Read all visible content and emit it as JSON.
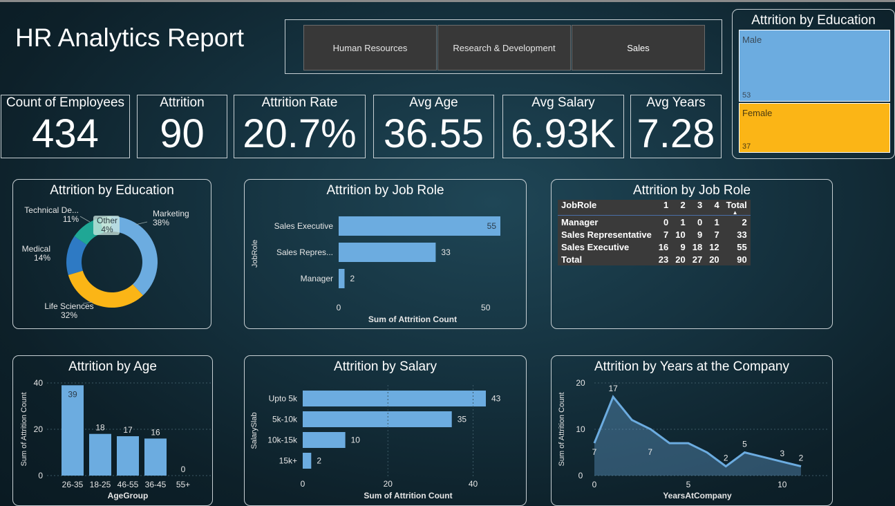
{
  "report": {
    "title": "HR Analytics Report"
  },
  "slicer": {
    "items": [
      "Human Resources",
      "Research & Development",
      "Sales"
    ],
    "selected": "Sales"
  },
  "kpis": [
    {
      "label": "Count of Employees",
      "value": "434"
    },
    {
      "label": "Attrition",
      "value": "90"
    },
    {
      "label": "Attrition Rate",
      "value": "20.7%"
    },
    {
      "label": "Avg Age",
      "value": "36.55"
    },
    {
      "label": "Avg Salary",
      "value": "6.93K"
    },
    {
      "label": "Avg Years",
      "value": "7.28"
    }
  ],
  "colors": {
    "bar": "#6cace0",
    "gold": "#fbb516",
    "medical": "#2e7ac4",
    "technical": "#1fa795",
    "other": "#9ad3c4"
  },
  "gender_treemap": {
    "title": "Attrition by Education",
    "items": [
      {
        "label": "Male",
        "value": "53"
      },
      {
        "label": "Female",
        "value": "37"
      }
    ]
  },
  "table": {
    "title": "Attrition by Job Role",
    "headers": [
      "JobRole",
      "1",
      "2",
      "3",
      "4",
      "Total"
    ],
    "rows": [
      [
        "Manager",
        "0",
        "1",
        "0",
        "1",
        "2"
      ],
      [
        "Sales Representative",
        "7",
        "10",
        "9",
        "7",
        "33"
      ],
      [
        "Sales Executive",
        "16",
        "9",
        "18",
        "12",
        "55"
      ]
    ],
    "total_row": [
      "Total",
      "23",
      "20",
      "27",
      "20",
      "90"
    ]
  },
  "chart_data": [
    {
      "id": "education",
      "type": "pie",
      "title": "Attrition by Education",
      "slices": [
        {
          "name": "Marketing",
          "value": 38,
          "label": "38%"
        },
        {
          "name": "Life Sciences",
          "value": 32,
          "label": "32%"
        },
        {
          "name": "Medical",
          "value": 14,
          "label": "14%"
        },
        {
          "name": "Technical De...",
          "value": 11,
          "label": "11%"
        },
        {
          "name": "Other",
          "value": 4,
          "label": "4%"
        }
      ]
    },
    {
      "id": "jobrole",
      "type": "bar",
      "orientation": "horizontal",
      "title": "Attrition by Job Role",
      "categories": [
        "Sales Executive",
        "Sales Repres...",
        "Manager"
      ],
      "values": [
        55,
        33,
        2
      ],
      "xlabel": "Sum of Attrition Count",
      "ylabel": "JobRole",
      "xlim": [
        0,
        55
      ],
      "ticks": [
        "0",
        "50"
      ]
    },
    {
      "id": "age",
      "type": "bar",
      "title": "Attrition by Age",
      "categories": [
        "26-35",
        "18-25",
        "46-55",
        "36-45",
        "55+"
      ],
      "values": [
        39,
        18,
        17,
        16,
        0
      ],
      "xlabel": "AgeGroup",
      "ylabel": "Sum of Attrition Count",
      "ylim": [
        0,
        40
      ],
      "ticks": [
        "0",
        "20",
        "40"
      ]
    },
    {
      "id": "salary",
      "type": "bar",
      "orientation": "horizontal",
      "title": "Attrition by Salary",
      "categories": [
        "Upto 5k",
        "5k-10k",
        "10k-15k",
        "15k+"
      ],
      "values": [
        43,
        35,
        10,
        2
      ],
      "xlabel": "Sum of Attrition Count",
      "ylabel": "SalarySlab",
      "xlim": [
        0,
        43
      ],
      "ticks": [
        "0",
        "20",
        "40"
      ]
    },
    {
      "id": "years",
      "type": "area",
      "title": "Attrition by Years at the Company",
      "x": [
        0,
        1,
        2,
        3,
        4,
        5,
        6,
        7,
        8,
        9,
        10,
        11
      ],
      "values": [
        7,
        17,
        12,
        10,
        7,
        7,
        5,
        2,
        5,
        4,
        3,
        2
      ],
      "labels": [
        "7",
        "17",
        "",
        "",
        "7",
        "",
        "",
        "2",
        "5",
        "",
        "3",
        "2"
      ],
      "xlabel": "YearsAtCompany",
      "ylabel": "Sum of Attrition Count",
      "xlim": [
        0,
        11
      ],
      "ylim": [
        0,
        20
      ],
      "xticks": [
        "0",
        "5",
        "10"
      ],
      "yticks": [
        "0",
        "10",
        "20"
      ]
    }
  ]
}
